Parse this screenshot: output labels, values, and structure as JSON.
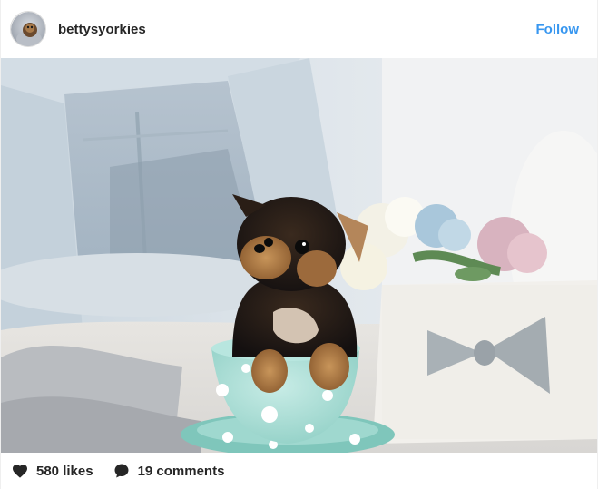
{
  "post": {
    "username": "bettysyorkies",
    "follow_label": "Follow",
    "likes_label": "580 likes",
    "comments_label": "19 comments"
  },
  "icons": {
    "avatar": "profile-avatar",
    "like": "heart-icon",
    "comment": "comment-bubble-icon"
  },
  "colors": {
    "link": "#3897f0",
    "text": "#262626",
    "icon": "#262626"
  }
}
